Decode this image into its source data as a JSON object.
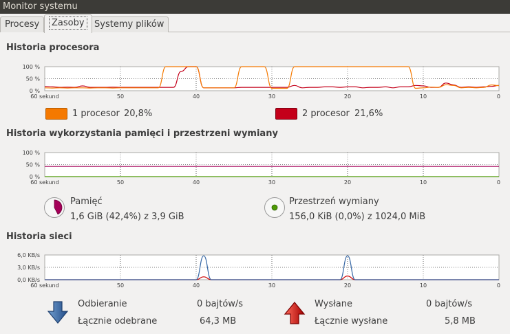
{
  "window": {
    "title": "Monitor systemu"
  },
  "tabs": [
    {
      "label": "Procesy",
      "active": false
    },
    {
      "label": "Zasoby",
      "active": true
    },
    {
      "label": "Systemy plików",
      "active": false
    }
  ],
  "cpu": {
    "title": "Historia procesora",
    "y_ticks": [
      "100 %",
      "50 %",
      "0 %"
    ],
    "x_ticks": [
      "60 sekund",
      "50",
      "40",
      "30",
      "20",
      "10",
      "0"
    ],
    "legend": [
      {
        "label": "1 procesor",
        "value": "20,8%",
        "color": "#f57900",
        "border": "#b35a00"
      },
      {
        "label": "2 procesor",
        "value": "21,6%",
        "color": "#c4001a",
        "border": "#7a0011"
      }
    ]
  },
  "memory": {
    "title": "Historia wykorzystania pamięci i przestrzeni wymiany",
    "y_ticks": [
      "100 %",
      "50 %",
      "0 %"
    ],
    "x_ticks": [
      "60 sekund",
      "50",
      "40",
      "30",
      "20",
      "10",
      "0"
    ],
    "ram": {
      "label": "Pamięć",
      "detail": "1,6 GiB (42,4%) z 3,9 GiB",
      "color": "#a40058",
      "fraction": 0.424
    },
    "swap": {
      "label": "Przestrzeń wymiany",
      "detail": "156,0 KiB (0,0%) z 1024,0 MiB",
      "color": "#4e9a06",
      "fraction": 0.0
    }
  },
  "network": {
    "title": "Historia sieci",
    "y_ticks": [
      "6,0 KB/s",
      "3,0 KB/s",
      "0,0 KB/s"
    ],
    "x_ticks": [
      "60 sekund",
      "50",
      "40",
      "30",
      "20",
      "10",
      "0"
    ],
    "receiving": {
      "label": "Odbieranie",
      "rate": "0 bajtów/s",
      "total_label": "Łącznie odebrane",
      "total": "64,3 MB",
      "color": "#3465a4"
    },
    "sending": {
      "label": "Wysłane",
      "rate": "0 bajtów/s",
      "total_label": "Łącznie wysłane",
      "total": "5,8 MB",
      "color": "#cc0000"
    }
  },
  "chart_data": [
    {
      "type": "line",
      "title": "Historia procesora",
      "x": [
        60,
        59,
        58,
        57,
        56,
        55,
        54,
        53,
        52,
        51,
        50,
        49,
        48,
        47,
        46,
        45,
        44,
        43,
        42,
        41,
        40,
        39,
        38,
        37,
        36,
        35,
        34,
        33,
        32,
        31,
        30,
        29,
        28,
        27,
        26,
        25,
        24,
        23,
        22,
        21,
        20,
        19,
        18,
        17,
        16,
        15,
        14,
        13,
        12,
        11,
        10,
        9,
        8,
        7,
        6,
        5,
        4,
        3,
        2,
        1,
        0
      ],
      "xlim": [
        60,
        0
      ],
      "ylim": [
        0,
        100
      ],
      "series": [
        {
          "name": "1 procesor",
          "values": [
            12,
            11,
            12,
            11,
            12,
            12,
            11,
            12,
            12,
            11,
            12,
            12,
            12,
            12,
            12,
            12,
            100,
            100,
            100,
            100,
            100,
            12,
            12,
            12,
            12,
            12,
            100,
            100,
            100,
            100,
            10,
            10,
            10,
            100,
            100,
            100,
            100,
            100,
            100,
            100,
            100,
            100,
            100,
            100,
            100,
            100,
            100,
            100,
            100,
            10,
            12,
            15,
            14,
            25,
            22,
            12,
            14,
            12,
            14,
            24,
            21
          ]
        },
        {
          "name": "2 procesor",
          "values": [
            18,
            16,
            14,
            15,
            14,
            20,
            14,
            14,
            14,
            15,
            14,
            14,
            14,
            14,
            14,
            14,
            14,
            14,
            80,
            100,
            100,
            12,
            12,
            12,
            12,
            12,
            14,
            14,
            14,
            14,
            14,
            14,
            14,
            22,
            12,
            14,
            14,
            16,
            16,
            14,
            16,
            16,
            12,
            14,
            14,
            16,
            12,
            16,
            16,
            22,
            20,
            14,
            14,
            32,
            24,
            14,
            16,
            14,
            16,
            18,
            22
          ]
        }
      ]
    },
    {
      "type": "line",
      "title": "Historia wykorzystania pamięci i przestrzeni wymiany",
      "xlim": [
        60,
        0
      ],
      "ylim": [
        0,
        100
      ],
      "series": [
        {
          "name": "Pamięć",
          "values": [
            42.4,
            42.4
          ]
        },
        {
          "name": "Przestrzeń wymiany",
          "values": [
            0.0,
            0.0
          ]
        }
      ]
    },
    {
      "type": "line",
      "title": "Historia sieci",
      "xlim": [
        60,
        0
      ],
      "ylim": [
        0,
        6
      ],
      "series": [
        {
          "name": "Odbieranie",
          "x": [
            60,
            42,
            41,
            40,
            39,
            38,
            22,
            21,
            20,
            19,
            18,
            0
          ],
          "values": [
            0,
            0,
            0,
            0,
            5.8,
            0,
            0,
            0,
            5.8,
            0,
            0,
            0
          ]
        },
        {
          "name": "Wysłane",
          "x": [
            60,
            43,
            42,
            41,
            40,
            39,
            38,
            23,
            22,
            21,
            20,
            19,
            18,
            0
          ],
          "values": [
            0,
            0,
            0,
            0,
            0,
            0.7,
            0,
            0,
            0,
            0,
            0.9,
            0,
            0,
            0
          ]
        }
      ]
    }
  ]
}
